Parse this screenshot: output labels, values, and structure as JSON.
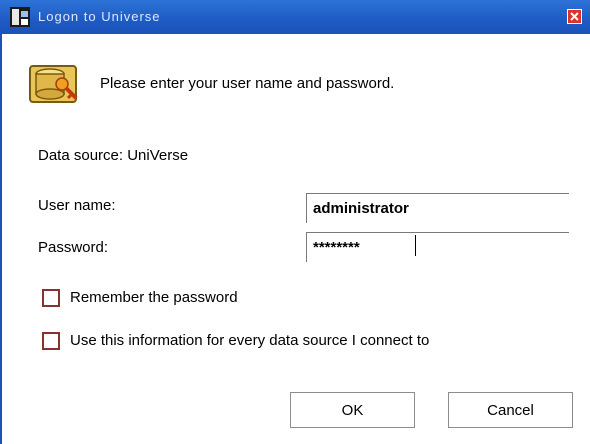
{
  "window": {
    "title": "Logon to Universe",
    "close_icon": "close-icon",
    "app_icon": "app-icon"
  },
  "header": {
    "icon": "key-database-icon",
    "prompt": "Please enter your user name and password."
  },
  "datasource": {
    "text": "Data source: UniVerse"
  },
  "form": {
    "username_label": "User name:",
    "username_value": "administrator",
    "password_label": "Password:",
    "password_value": "********"
  },
  "options": {
    "remember_label": "Remember the password",
    "remember_checked": false,
    "use_info_label": "Use this information for every data source I connect to",
    "use_info_checked": false
  },
  "buttons": {
    "ok_label": "OK",
    "cancel_label": "Cancel"
  },
  "colors": {
    "titlebar": "#1e5bc4",
    "close": "#d9342b",
    "checkbox_border": "#8a3030"
  }
}
